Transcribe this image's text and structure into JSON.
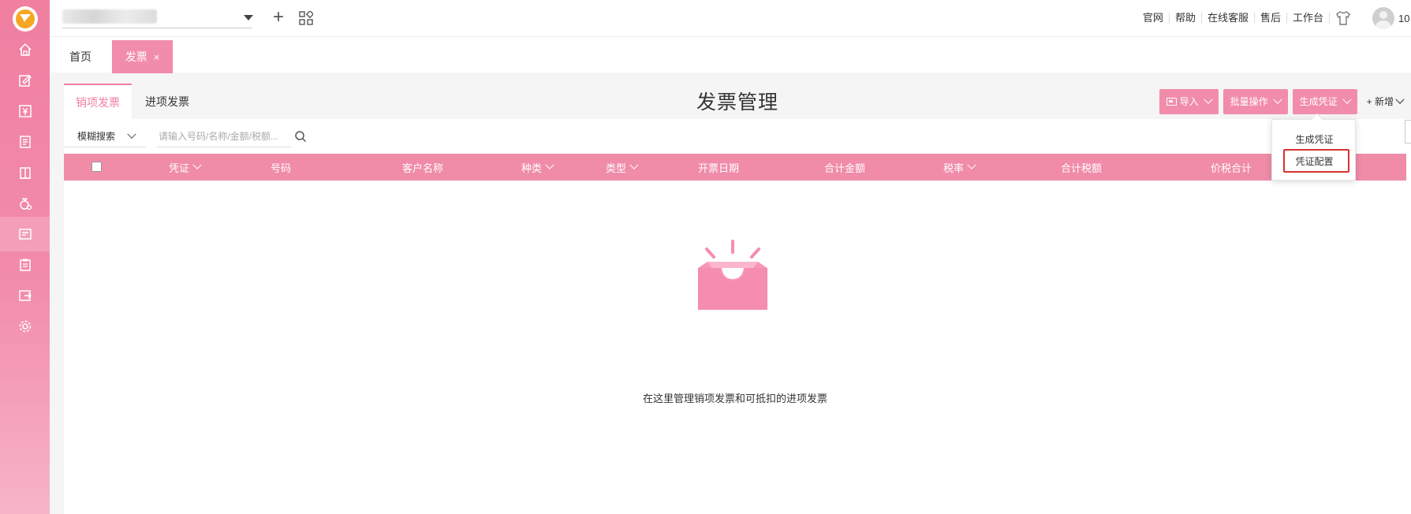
{
  "sidebar": {
    "items": [
      {
        "name": "home-icon"
      },
      {
        "name": "edit-note-icon"
      },
      {
        "name": "yen-icon"
      },
      {
        "name": "ledger-icon"
      },
      {
        "name": "book-icon"
      },
      {
        "name": "money-bag-icon"
      },
      {
        "name": "invoice-icon",
        "active": true
      },
      {
        "name": "report-icon"
      },
      {
        "name": "export-icon"
      },
      {
        "name": "settings-icon"
      }
    ]
  },
  "topbar": {
    "links": [
      "官网",
      "帮助",
      "在线客服",
      "售后",
      "工作台"
    ],
    "user_num": "10"
  },
  "tabs": {
    "home": "首页",
    "invoice": "发票",
    "close": "×"
  },
  "page": {
    "title": "发票管理",
    "subtabs": {
      "sales": "销项发票",
      "purchase": "进项发票"
    },
    "actions": {
      "import": "导入",
      "batch": "批量操作",
      "generate": "生成凭证",
      "add": "+ 新增"
    },
    "search": {
      "mode": "模糊搜索",
      "placeholder": "请输入号码/名称/金额/税额..."
    },
    "table": {
      "columns": [
        "凭证",
        "号码",
        "客户名称",
        "种类",
        "类型",
        "开票日期",
        "合计金额",
        "税率",
        "合计税额",
        "价税合计"
      ]
    },
    "empty_text": "在这里管理销项发票和可抵扣的进项发票"
  },
  "dropdown": {
    "items": [
      "生成凭证",
      "凭证配置"
    ]
  },
  "colors": {
    "brand": "#f28cab",
    "header": "#f08ba8",
    "highlight": "#d93030"
  }
}
